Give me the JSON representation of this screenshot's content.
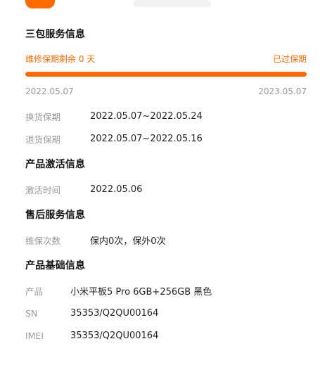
{
  "header": {
    "app_icon": "orange-app-icon"
  },
  "sections": {
    "warranty_title": "三包服务信息",
    "activation_title": "产品激活信息",
    "after_sales_title": "售后服务信息",
    "basic_title": "产品基础信息"
  },
  "warranty": {
    "remaining_label": "维修保期剩余 0 天",
    "status_label": "已过保期",
    "start_date": "2022.05.07",
    "end_date": "2023.05.07",
    "progress_percent": 100,
    "accent_color": "#ff6a00"
  },
  "warranty_details": [
    {
      "key": "换货保期",
      "value": "2022.05.07~2022.05.24"
    },
    {
      "key": "退货保期",
      "value": "2022.05.07~2022.05.16"
    }
  ],
  "activation": [
    {
      "key": "激活时间",
      "value": "2022.05.06"
    }
  ],
  "after_sales": [
    {
      "key": "维保次数",
      "value": "保内0次，保外0次"
    }
  ],
  "basic_info": [
    {
      "key": "产品",
      "value": "小米平板5 Pro 6GB+256GB 黑色"
    },
    {
      "key": "SN",
      "value": "35353/Q2QU00164"
    },
    {
      "key": "IMEI",
      "value": "35353/Q2QU00164"
    }
  ]
}
